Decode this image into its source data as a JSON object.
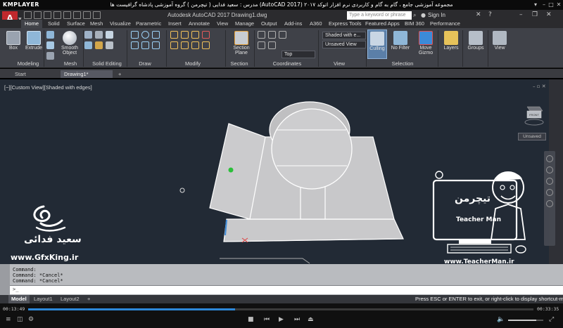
{
  "kmplayer": {
    "logo": "KMPLAYER",
    "title": "مجموعه آموزشی جامع ، گام به گام و کاربردی نرم افزار   اتوکد ۲۰۱۷ (AutoCAD 2017)   مدرس : سعید فدایی ( تیچرمن ) گروه آموزشی پادشاه گرافیست ها"
  },
  "autocad": {
    "logo": "A",
    "title": "Autodesk AutoCAD 2017    Drawing1.dwg",
    "search_placeholder": "Type a keyword or phrase",
    "sign_in": "Sign In"
  },
  "ribbon_tabs": [
    "Home",
    "Solid",
    "Surface",
    "Mesh",
    "Visualize",
    "Parametric",
    "Insert",
    "Annotate",
    "View",
    "Manage",
    "Output",
    "Add-ins",
    "A360",
    "Express Tools",
    "Featured Apps",
    "BIM 360",
    "Performance"
  ],
  "ribbon": {
    "box": "Box",
    "extrude": "Extrude",
    "smooth_object": "Smooth Object",
    "section_plane": "Section Plane",
    "visual_style": "Shaded with e...",
    "view_state": "Unsaved View",
    "view_dir": "Top",
    "culling": "Culling",
    "no_filter": "No Filter",
    "move_gizmo": "Move Gizmo",
    "layers": "Layers",
    "groups": "Groups",
    "view": "View",
    "panels": {
      "modeling": "Modeling",
      "mesh": "Mesh",
      "solid_editing": "Solid Editing",
      "draw": "Draw",
      "modify": "Modify",
      "section": "Section",
      "coordinates": "Coordinates",
      "view": "View",
      "selection": "Selection"
    }
  },
  "file_tabs": {
    "start": "Start",
    "drawing": "Drawing1*",
    "add": "+"
  },
  "viewport": {
    "label": "[−][Custom View][Shaded with edges]",
    "viewcube_face": "FRONT",
    "unsaved": "Unsaved"
  },
  "watermarks": {
    "left_name": "سعید فدائی",
    "left_url": "www.GfxKing.ir",
    "right_logo": "تیچرمن",
    "right_brand": "Teacher Man",
    "right_url": "www.TeacherMan.ir"
  },
  "command": {
    "history": [
      "Command:",
      "Command: *Cancel*",
      "Command: *Cancel*"
    ],
    "prompt": ">_ "
  },
  "status": {
    "tabs": [
      "Model",
      "Layout1",
      "Layout2"
    ],
    "add": "+",
    "message": "Press ESC or ENTER to exit, or right-click to display shortcut-menu."
  },
  "player": {
    "time_elapsed": "00:13:49",
    "time_total": "00:33:35",
    "progress": 0.41,
    "volume": 0.8
  },
  "colors": {
    "viewport_bg": "#222a35",
    "ribbon_bg": "#3f4148",
    "model_fill": "#c9c9cb",
    "model_edge": "#ffffff",
    "seek_fill": "#2d88d8"
  }
}
